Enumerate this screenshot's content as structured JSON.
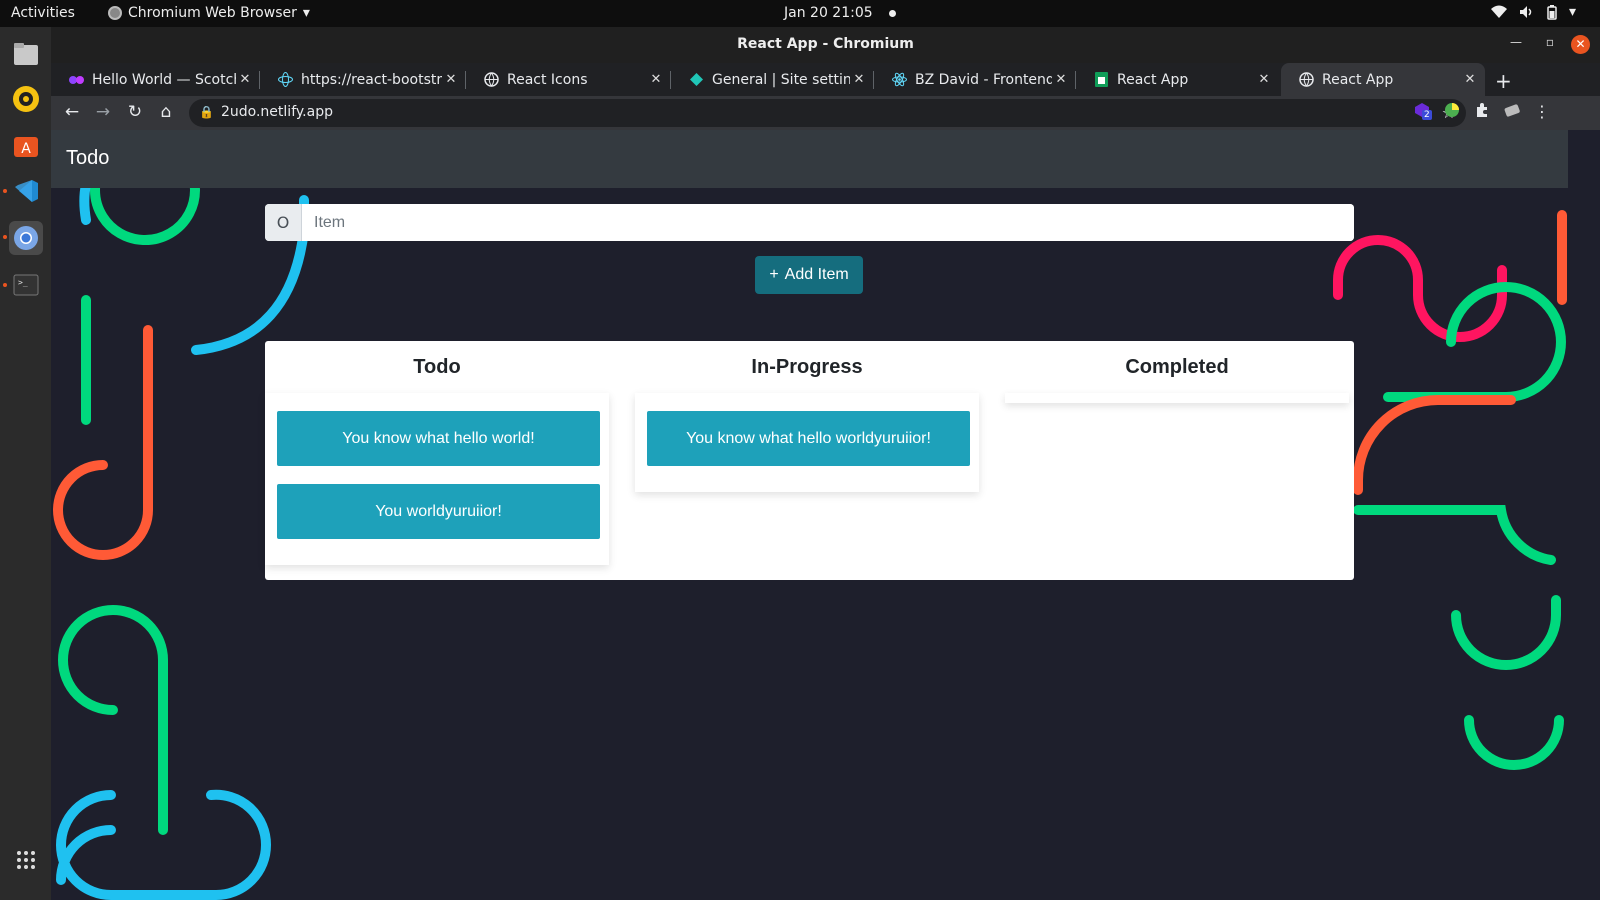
{
  "topbar": {
    "activities": "Activities",
    "app_name": "Chromium Web Browser",
    "clock": "Jan 20  21:05"
  },
  "window": {
    "title": "React App - Chromium"
  },
  "tabs": [
    {
      "title": "Hello World — Scotch",
      "favicon": "scotch-icon"
    },
    {
      "title": "https://react-bootstrap",
      "favicon": "react-bootstrap-icon"
    },
    {
      "title": "React Icons",
      "favicon": "globe-icon"
    },
    {
      "title": "General | Site settings",
      "favicon": "netlify-icon"
    },
    {
      "title": "BZ David - Frontend D",
      "favicon": "react-icon"
    },
    {
      "title": "React App",
      "favicon": "sheets-icon"
    },
    {
      "title": "React App",
      "favicon": "globe-icon",
      "active": true
    }
  ],
  "toolbar": {
    "url": "2udo.netlify.app",
    "ext_badge": "2"
  },
  "app": {
    "brand": "Todo",
    "input_prepend": "O",
    "input_placeholder": "Item",
    "add_button": "Add Item",
    "add_icon": "+",
    "columns": [
      {
        "title": "Todo",
        "items": [
          "You know what hello world!",
          "You worldyuruiior!"
        ]
      },
      {
        "title": "In-Progress",
        "items": [
          "You know what hello worldyuruiior!"
        ]
      },
      {
        "title": "Completed",
        "items": []
      }
    ]
  },
  "colors": {
    "accent": "#1ea1ba",
    "navbar": "#343a40",
    "page_bg": "#1e1f2c",
    "deco_green": "#00d97e",
    "deco_blue": "#1fc1f0",
    "deco_red": "#ff5a36",
    "deco_pink": "#ff1560"
  }
}
